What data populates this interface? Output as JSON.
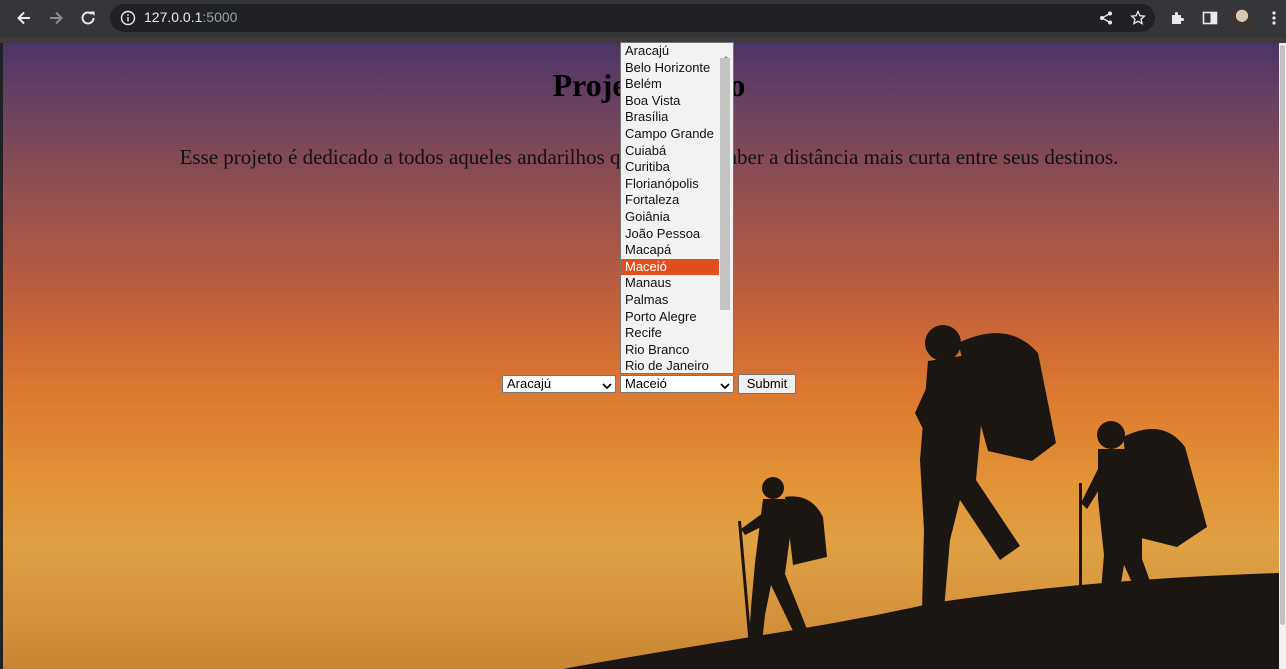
{
  "browser": {
    "url_host": "127.0.0.1",
    "url_port": ":5000"
  },
  "page": {
    "title": "Projeto Trilho",
    "description": "Esse projeto é dedicado a todos aqueles andarilhos que desejam saber a distância mais curta entre seus destinos."
  },
  "form": {
    "origin_value": "Aracajú",
    "destination_value": "Maceió",
    "submit_label": "Submit"
  },
  "dropdown": {
    "options": [
      "Aracajú",
      "Belo Horizonte",
      "Belém",
      "Boa Vista",
      "Brasília",
      "Campo Grande",
      "Cuiabá",
      "Curitiba",
      "Florianópolis",
      "Fortaleza",
      "Goiânia",
      "João Pessoa",
      "Macapá",
      "Maceió",
      "Manaus",
      "Palmas",
      "Porto Alegre",
      "Recife",
      "Rio Branco",
      "Rio de Janeiro"
    ],
    "selected": "Maceió"
  },
  "colors": {
    "selected_option_bg": "#e0501f",
    "chrome_bg": "#35363a"
  }
}
